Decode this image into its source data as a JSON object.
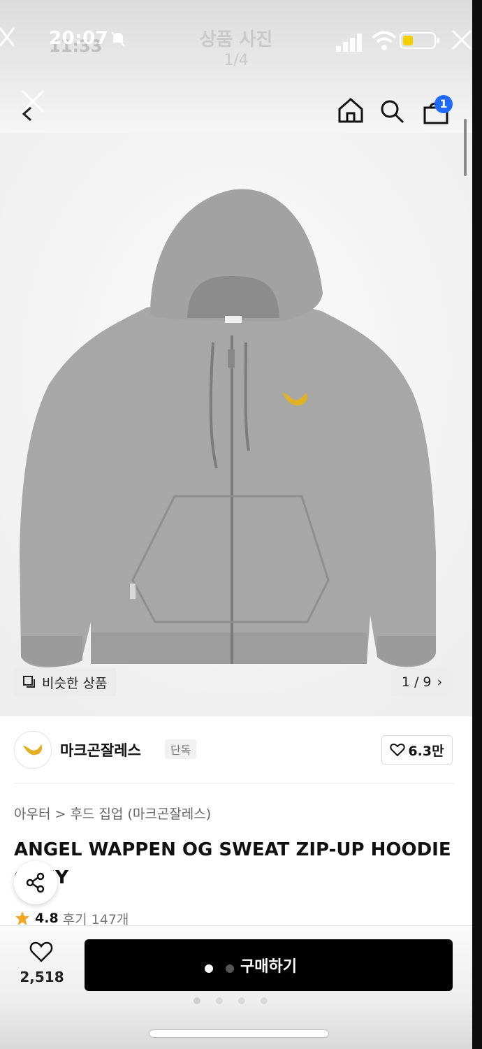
{
  "status_bar": {
    "time": "20:07",
    "time_ghost": "11:33"
  },
  "viewer": {
    "title": "상품 사진",
    "counter": "1/4"
  },
  "header": {
    "cart_count": "1"
  },
  "gallery": {
    "similar_label": "비슷한 상품",
    "page": "1 / 9",
    "next_glyph": "›"
  },
  "brand": {
    "name": "마크곤잘레스",
    "badge": "단독",
    "likes": "6.3만"
  },
  "product": {
    "breadcrumb": "아우터 > 후드 집업 (마크곤잘레스)",
    "title": "ANGEL WAPPEN OG SWEAT ZIP-UP HOODIE GREY",
    "rating": "4.8",
    "reviews": "후기 147개"
  },
  "bottom": {
    "wish_count": "2,518",
    "buy_label": "구매하기"
  },
  "colors": {
    "accent_badge": "#1f6bff",
    "buy_bg": "#000000",
    "star": "#f5a623",
    "logo_yellow": "#e2b023",
    "hoodie_grey": "#a9a9a9"
  },
  "icons": [
    "bell-slash-icon",
    "signal-icon",
    "wifi-icon",
    "battery-icon",
    "close-icon",
    "back-chevron-icon",
    "home-icon",
    "search-icon",
    "cart-icon",
    "copy-icon",
    "heart-icon",
    "share-icon",
    "star-icon"
  ]
}
